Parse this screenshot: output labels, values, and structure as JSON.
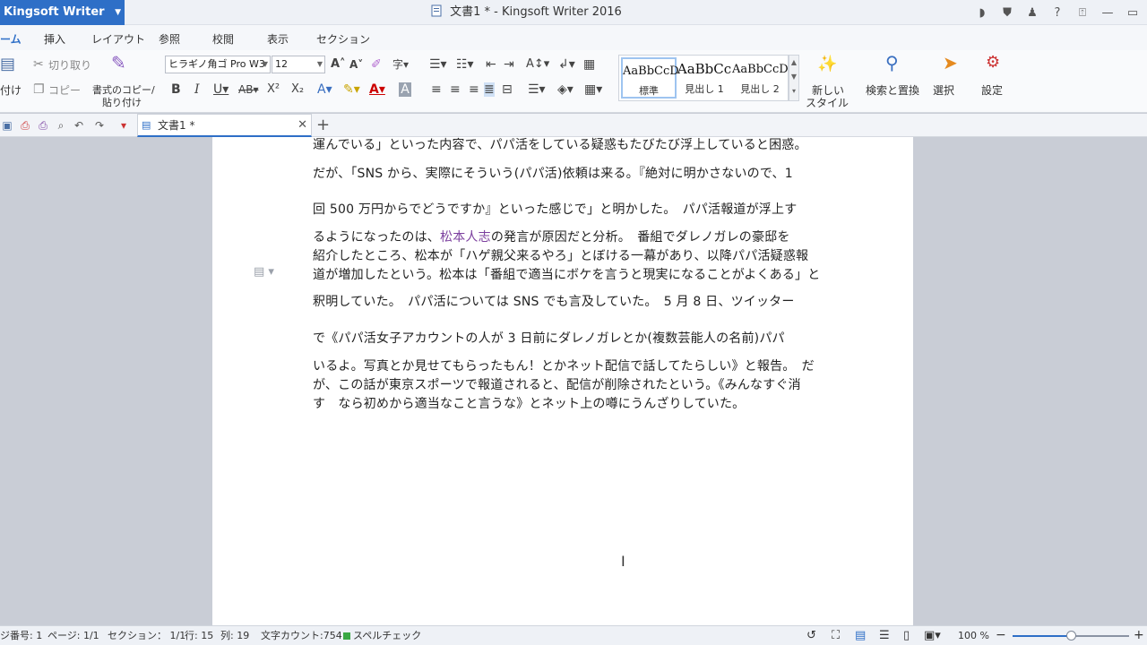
{
  "titlebar": {
    "app_name": "Kingsoft Writer 2016",
    "window_title": "文書1 * - Kingsoft Writer 2016"
  },
  "menu": {
    "tabs": [
      {
        "label": "ーム"
      },
      {
        "label": "挿入"
      },
      {
        "label": "レイアウト"
      },
      {
        "label": "参照"
      },
      {
        "label": "校閲"
      },
      {
        "label": "表示"
      },
      {
        "label": "セクション"
      }
    ]
  },
  "ribbon": {
    "paste_label": "付け",
    "cut_label": "切り取り",
    "copy_label": "コピー",
    "format_painter_line1": "書式のコピー/",
    "format_painter_line2": "貼り付け",
    "font_name": "ヒラギノ角ゴ Pro W3",
    "font_size": "12",
    "styles": [
      {
        "sample": "AaBbCcD",
        "name": "標準"
      },
      {
        "sample": "AaBbCc",
        "name": "見出し 1"
      },
      {
        "sample": "AaBbCcD",
        "name": "見出し 2"
      }
    ],
    "new_style_line1": "新しい",
    "new_style_line2": "スタイル",
    "find_replace": "検索と置換",
    "select": "選択",
    "settings": "設定"
  },
  "docbar": {
    "tab_label": "文書1 *"
  },
  "document": {
    "lines": [
      "運んでいる」といった内容で、パパ活をしている疑惑もたびたび浮上していると困惑。",
      "だが、「SNS から、実際にそういう(パパ活)依頼は来る。『絶対に明かさないので、1",
      "回 500 万円からでどうですか』といった感じで」と明かした。　パパ活報道が浮上す",
      "紹介したところ、松本が「ハゲ親父来るやろ」とぼける一幕があり、以降パパ活疑惑報",
      "道が増加したという。松本は「番組で適当にボケを言うと現実になることがよくある」と",
      "釈明していた。　パパ活については SNS でも言及していた。　5 月 8 日、ツイッター",
      "で《パパ活女子アカウントの人が 3 日前にダレノガレとか(複数芸能人の名前)パパ",
      "いるよ。写真とか見せてもらったもん！とかネット配信で話してたらしい》と報告。　だ",
      "が、この話が東京スポーツで報道されると、配信が削除されたという。《みんなすぐ消",
      "す　なら初めから適当なこと言うな》とネット上の噂にうんざりしていた。"
    ],
    "line4_prefix": "るようになったのは、",
    "line4_link": "松本人志",
    "line4_suffix": "の発言が原因だと分析。　番組でダレノガレの豪邸を"
  },
  "status": {
    "page_number": "ジ番号: 1",
    "page": "ページ: 1/1",
    "section": "セクション： 1/1",
    "row": "行: 15",
    "col": "列: 19",
    "word_count": "文字カウント:754",
    "spell_check": "スペルチェック",
    "zoom": "100 %",
    "zoom_fraction": 0.5
  }
}
